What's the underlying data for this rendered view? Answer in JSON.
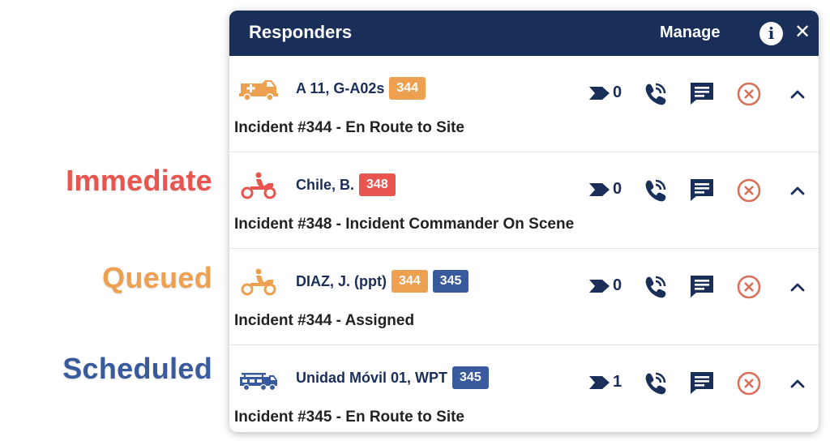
{
  "legend": {
    "immediate": {
      "label": "Immediate",
      "color": "#e8554e"
    },
    "queued": {
      "label": "Queued",
      "color": "#eda04f"
    },
    "scheduled": {
      "label": "Scheduled",
      "color": "#3a5a9e"
    }
  },
  "panel": {
    "title": "Responders",
    "manage_label": "Manage",
    "info_glyph": "i",
    "close_glyph": "✕"
  },
  "colors": {
    "header_bg": "#1a2e5a",
    "orange": "#eda04f",
    "red": "#e8554e",
    "blue": "#3a5a9e",
    "cancel": "#d9705a"
  },
  "responders": [
    {
      "name": "A 11, G-A02s",
      "icon": "ambulance-icon",
      "badges": [
        {
          "text": "344",
          "color": "#eda04f"
        }
      ],
      "count": "0",
      "status": "Incident #344 - En Route to Site"
    },
    {
      "name": "Chile, B.",
      "icon": "motorcycle-icon",
      "badges": [
        {
          "text": "348",
          "color": "#e8554e"
        }
      ],
      "count": "0",
      "status": "Incident #348 - Incident Commander On Scene"
    },
    {
      "name": "DIAZ, J. (ppt)",
      "icon": "motorcycle-icon",
      "badges": [
        {
          "text": "344",
          "color": "#eda04f"
        },
        {
          "text": "345",
          "color": "#3a5a9e"
        }
      ],
      "count": "0",
      "status": "Incident #344 - Assigned"
    },
    {
      "name": "Unidad Móvil 01, WPT",
      "icon": "fire-truck-icon",
      "badges": [
        {
          "text": "345",
          "color": "#3a5a9e"
        }
      ],
      "count": "1",
      "status": "Incident #345 - En Route to Site"
    }
  ]
}
